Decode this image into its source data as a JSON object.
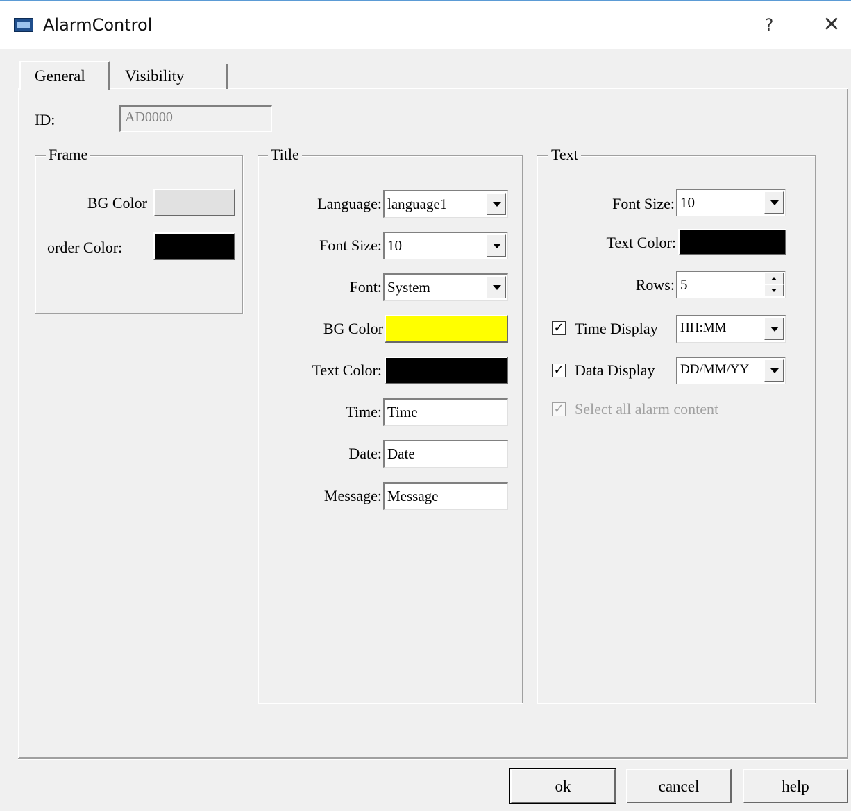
{
  "window": {
    "title": "AlarmControl",
    "help_glyph": "?",
    "close_glyph": "✕",
    "icon": "hmi-app-icon"
  },
  "tabs": [
    {
      "label": "General",
      "active": true
    },
    {
      "label": "Visibility",
      "active": false
    }
  ],
  "id_field": {
    "label": "ID:",
    "value": "AD0000"
  },
  "frame": {
    "title": "Frame",
    "bg_color_label": "BG Color",
    "bg_color": "#e1e1e1",
    "border_color_label": "order Color:",
    "border_color": "#000000"
  },
  "title_group": {
    "title": "Title",
    "language_label": "Language:",
    "language_value": "language1",
    "font_size_label": "Font Size:",
    "font_size_value": "10",
    "font_label": "Font:",
    "font_value": "System",
    "bg_color_label": "BG Color",
    "bg_color": "#ffff00",
    "text_color_label": "Text Color:",
    "text_color": "#000000",
    "time_label": "Time:",
    "time_value": "Time",
    "date_label": "Date:",
    "date_value": "Date",
    "message_label": "Message:",
    "message_value": "Message"
  },
  "text_group": {
    "title": "Text",
    "font_size_label": "Font Size:",
    "font_size_value": "10",
    "text_color_label": "Text Color:",
    "text_color": "#000000",
    "rows_label": "Rows:",
    "rows_value": "5",
    "time_display_label": "Time Display",
    "time_display_checked": true,
    "time_display_value": "HH:MM",
    "data_display_label": "Data Display",
    "data_display_checked": true,
    "data_display_value": "DD/MM/YY",
    "select_all_label": "Select all alarm content",
    "select_all_checked": true,
    "select_all_disabled": true
  },
  "buttons": {
    "ok": "ok",
    "cancel": "cancel",
    "help": "help"
  }
}
